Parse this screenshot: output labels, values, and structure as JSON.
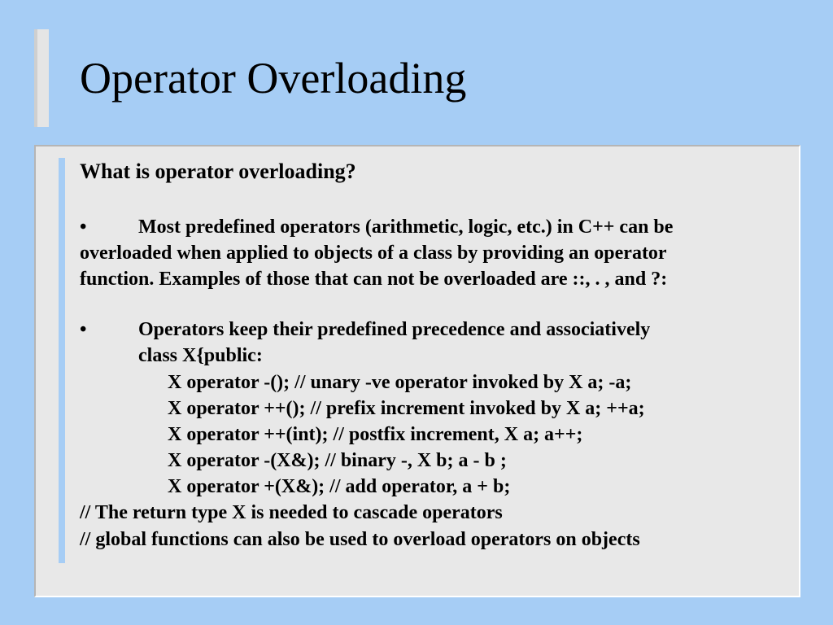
{
  "title": "Operator Overloading",
  "heading": "What is operator overloading?",
  "para1_lead": "Most predefined operators (arithmetic, logic, etc.) in C++ can be",
  "para1_cont1": "overloaded when applied to objects of  a class by providing an operator",
  "para1_cont2": "function. Examples of those that can not  be overloaded are ::, . ,  and ?:",
  "para2_lead": "Operators keep their predefined precedence and associatively",
  "code": {
    "l1": "class X{public:",
    "l2": "X operator -(); // unary -ve operator invoked by X a; -a;",
    "l3": "X operator ++(); // prefix increment invoked by X a; ++a;",
    "l4": "X operator ++(int); // postfix increment, X a; a++;",
    "l5": "X operator -(X&); // binary -, X b; a - b ;",
    "l6": "X operator +(X&); // add operator,  a + b;"
  },
  "comment1": "// The return type X is needed to cascade operators",
  "comment2": "// global functions can also be used to overload operators on objects"
}
